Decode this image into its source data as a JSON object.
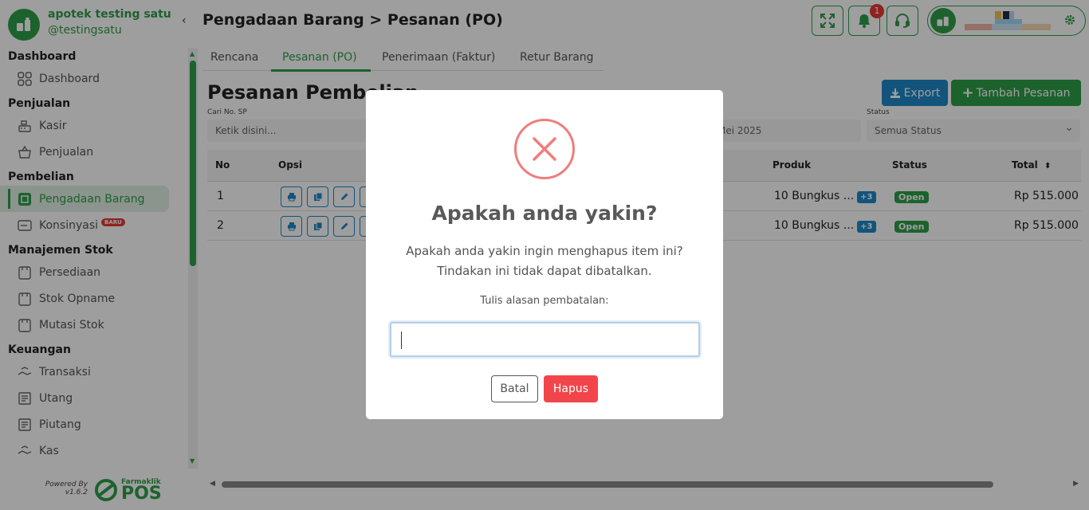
{
  "brand": {
    "name": "apotek testing satu",
    "user": "@testingsatu"
  },
  "sidebar": {
    "sections": [
      {
        "title": "Dashboard",
        "items": [
          {
            "label": "Dashboard",
            "icon": "grid-icon"
          }
        ]
      },
      {
        "title": "Penjualan",
        "items": [
          {
            "label": "Kasir",
            "icon": "cash-register-icon"
          },
          {
            "label": "Penjualan",
            "icon": "basket-icon"
          }
        ]
      },
      {
        "title": "Pembelian",
        "items": [
          {
            "label": "Pengadaan Barang",
            "icon": "box-icon",
            "active": true
          },
          {
            "label": "Konsinyasi",
            "icon": "tag-icon",
            "badge": "BARU"
          }
        ]
      },
      {
        "title": "Manajemen Stok",
        "items": [
          {
            "label": "Persediaan",
            "icon": "clipboard-icon"
          },
          {
            "label": "Stok Opname",
            "icon": "clipboard-check-icon"
          },
          {
            "label": "Mutasi Stok",
            "icon": "transfer-box-icon"
          }
        ]
      },
      {
        "title": "Keuangan",
        "items": [
          {
            "label": "Transaksi",
            "icon": "hand-money-icon"
          },
          {
            "label": "Utang",
            "icon": "receipt-icon"
          },
          {
            "label": "Piutang",
            "icon": "receipt-icon"
          },
          {
            "label": "Kas",
            "icon": "hand-money-icon"
          }
        ]
      }
    ],
    "powered_by": "Powered By",
    "version": "v1.6.2",
    "pos_small": "Farmaklik",
    "pos_big": "POS"
  },
  "header": {
    "title": "Pengadaan Barang > Pesanan (PO)",
    "notif_count": "1"
  },
  "tabs": [
    "Rencana",
    "Pesanan (PO)",
    "Penerimaan (Faktur)",
    "Retur Barang"
  ],
  "page": {
    "title": "Pesanan Pembelian",
    "export_label": "Export",
    "add_label": "Tambah Pesanan",
    "filters": {
      "sp_label": "Cari No. SP",
      "sp_placeholder": "Ketik disini...",
      "date_value": "Mei 2025",
      "status_label": "Status",
      "status_value": "Semua Status"
    }
  },
  "table": {
    "headers": {
      "no": "No",
      "opsi": "Opsi",
      "produk": "Produk",
      "status": "Status",
      "total": "Total"
    },
    "rows": [
      {
        "no": "1",
        "produk": "10 Bungkus ...",
        "more": "+3",
        "status": "Open",
        "total": "Rp 515.000"
      },
      {
        "no": "2",
        "produk": "10 Bungkus ...",
        "more": "+3",
        "status": "Open",
        "total": "Rp 515.000"
      }
    ]
  },
  "modal": {
    "title": "Apakah anda yakin?",
    "line1": "Apakah anda yakin ingin menghapus item ini?",
    "line2": "Tindakan ini tidak dapat dibatalkan.",
    "label": "Tulis alasan pembatalan:",
    "input_value": "",
    "cancel_label": "Batal",
    "confirm_label": "Hapus"
  },
  "colors": {
    "brand_green": "#2e9e4a",
    "accent_blue": "#1f88c9",
    "danger_red": "#f2454b",
    "error_icon": "#f07d7d"
  }
}
